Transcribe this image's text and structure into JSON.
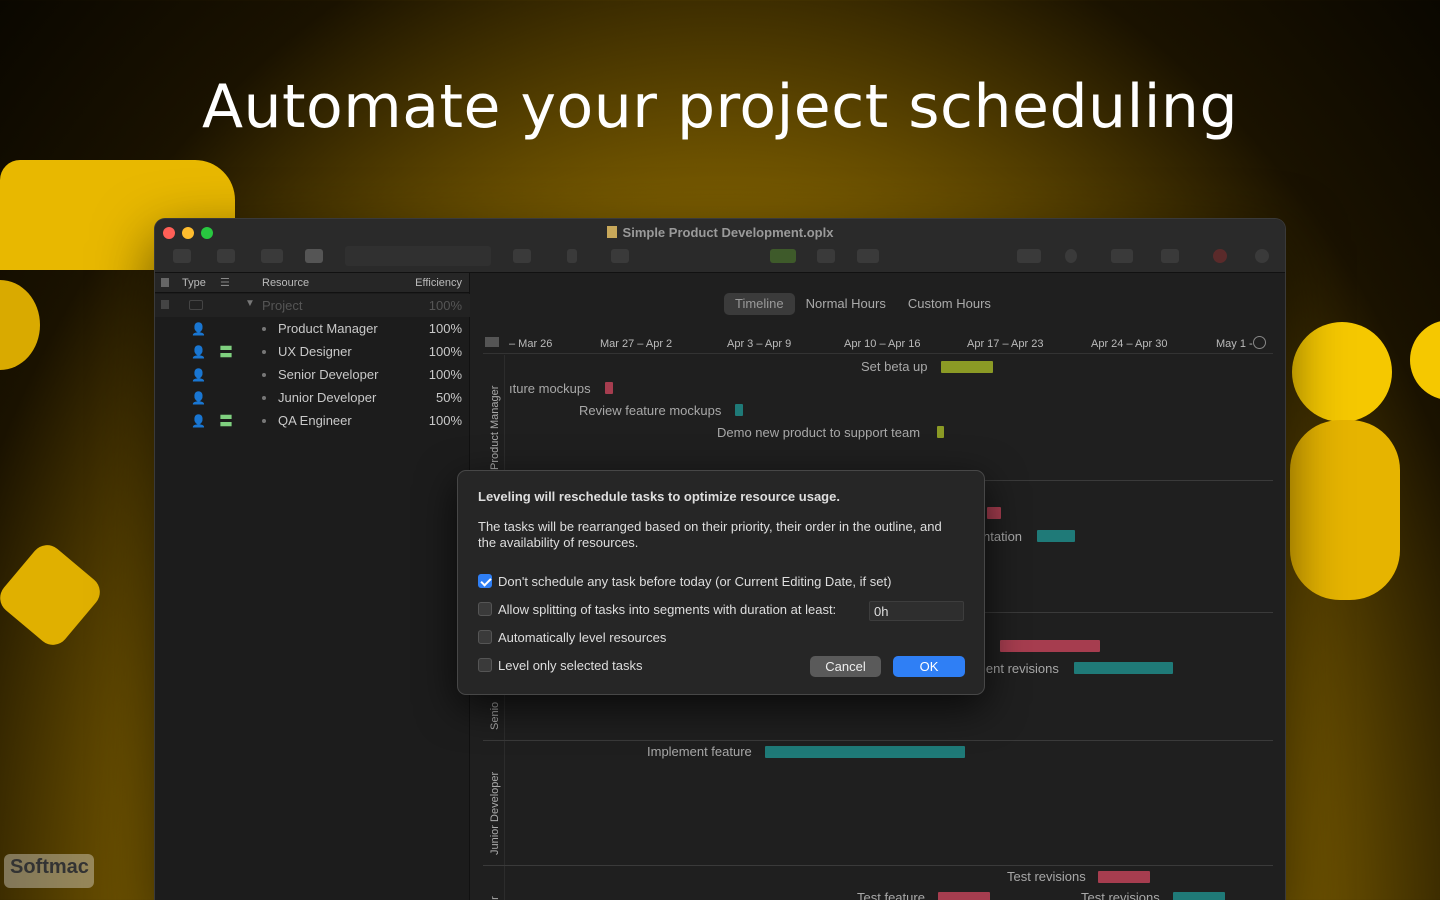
{
  "headline": "Automate your project scheduling",
  "window": {
    "title": "Simple Product Development.oplx",
    "traffic_colors": [
      "#ff5f57",
      "#febc2e",
      "#28c840"
    ]
  },
  "outline": {
    "headers": {
      "type": "Type",
      "resource": "Resource",
      "efficiency": "Efficiency"
    },
    "project": {
      "name": "Project",
      "efficiency": "100%"
    },
    "rows": [
      {
        "name": "Product Manager",
        "efficiency": "100%"
      },
      {
        "name": "UX Designer",
        "efficiency": "100%"
      },
      {
        "name": "Senior Developer",
        "efficiency": "100%"
      },
      {
        "name": "Junior Developer",
        "efficiency": "50%"
      },
      {
        "name": "QA Engineer",
        "efficiency": "100%"
      }
    ]
  },
  "view_tabs": {
    "timeline": "Timeline",
    "normal": "Normal Hours",
    "custom": "Custom Hours"
  },
  "timeline_headers": [
    "– Mar 26",
    "Mar 27 – Apr 2",
    "Apr 3 – Apr 9",
    "Apr 10 – Apr 16",
    "Apr 17 – Apr 23",
    "Apr 24 – Apr 30",
    "May 1 -"
  ],
  "lanes": {
    "pm": "Product Manager",
    "senior": "Senio",
    "junior": "Junior Developer",
    "qa": "er"
  },
  "tasks": {
    "set_beta_up": "Set beta up",
    "feature_mockups": "ıture mockups",
    "review_mockups": "Review feature mockups",
    "demo": "Demo new product to support team",
    "implementation": "ntation",
    "implement_revisions": "ient revisions",
    "implement_feature": "Implement feature",
    "test_revisions": "Test revisions",
    "test_feature": "Test feature",
    "test_revisions_2": "Test revisions"
  },
  "colors": {
    "bar_olive": "#8b9a25",
    "bar_teal": "#1f7a78",
    "bar_red": "#a63d4f",
    "accent_blue": "#2f7ff5"
  },
  "dialog": {
    "heading": "Leveling will reschedule tasks to optimize resource usage.",
    "body": "The tasks will be rearranged based on their priority, their order in the outline, and the availability of resources.",
    "options": [
      {
        "label": "Don't schedule any task before today (or Current Editing Date, if set)",
        "checked": true
      },
      {
        "label": "Allow splitting of tasks into segments with duration at least:",
        "checked": false
      },
      {
        "label": "Automatically level resources",
        "checked": false
      },
      {
        "label": "Level only selected tasks",
        "checked": false
      }
    ],
    "duration_value": "0h",
    "cancel": "Cancel",
    "ok": "OK"
  },
  "watermark": "Softmac"
}
